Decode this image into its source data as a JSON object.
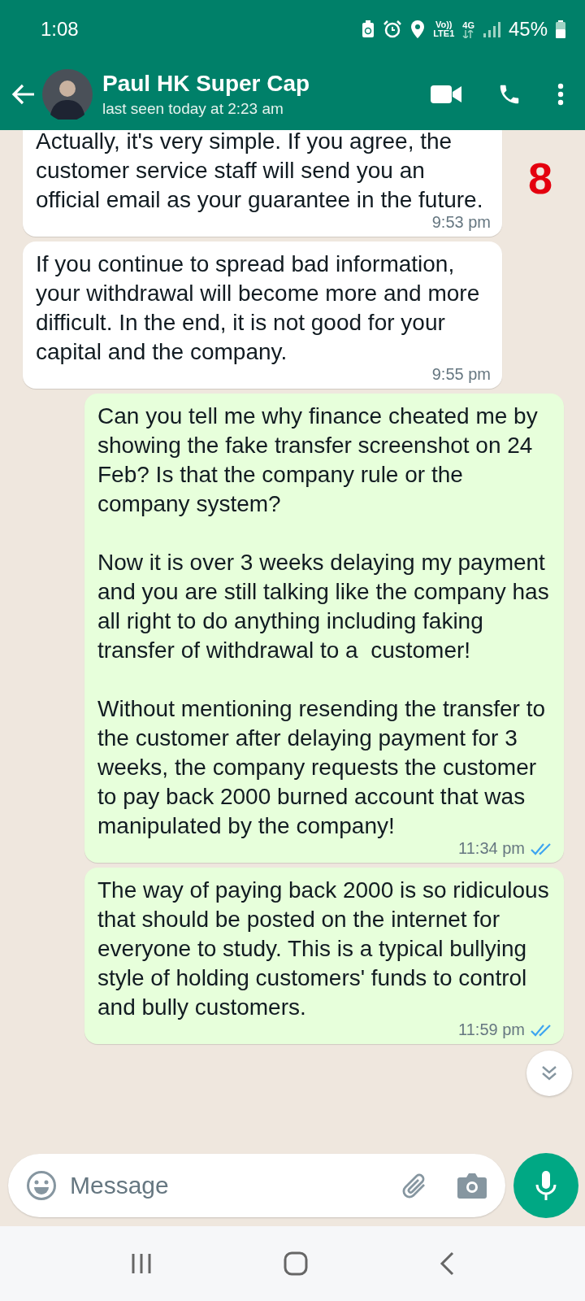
{
  "status_bar": {
    "time": "1:08",
    "volte": "Vo))",
    "lte": "LTE1",
    "data_type": "4G",
    "battery": "45%"
  },
  "header": {
    "name": "Paul HK Super Cap",
    "status": "last seen today at 2:23 am"
  },
  "annotation": "8",
  "messages": [
    {
      "kind": "incoming",
      "text": "Actually, it's very simple. If you agree, the customer service staff will send you an official email as your guarantee in the future.",
      "time": "9:53 pm"
    },
    {
      "kind": "incoming",
      "text": "If you continue to spread bad information, your withdrawal will become more and more difficult. In the end, it is not good for your capital and the company.",
      "time": "9:55 pm"
    },
    {
      "kind": "outgoing",
      "text": "Can you tell me why finance cheated me by showing the fake transfer screenshot on 24 Feb? Is that the company rule or the company system?\n\nNow it is over 3 weeks delaying my payment and you are still talking like the company has all right to do anything including faking transfer of withdrawal to a  customer!\n\nWithout mentioning resending the transfer to the customer after delaying payment for 3 weeks, the company requests the customer to pay back 2000 burned account that was manipulated by the company!",
      "time": "11:34 pm",
      "read": true
    },
    {
      "kind": "outgoing",
      "text": "The way of paying back 2000 is so ridiculous that should be posted on the internet for everyone to study. This is a typical bullying style of holding customers' funds to control and bully customers.",
      "time": "11:59 pm",
      "read": true
    }
  ],
  "composer": {
    "placeholder": "Message"
  }
}
